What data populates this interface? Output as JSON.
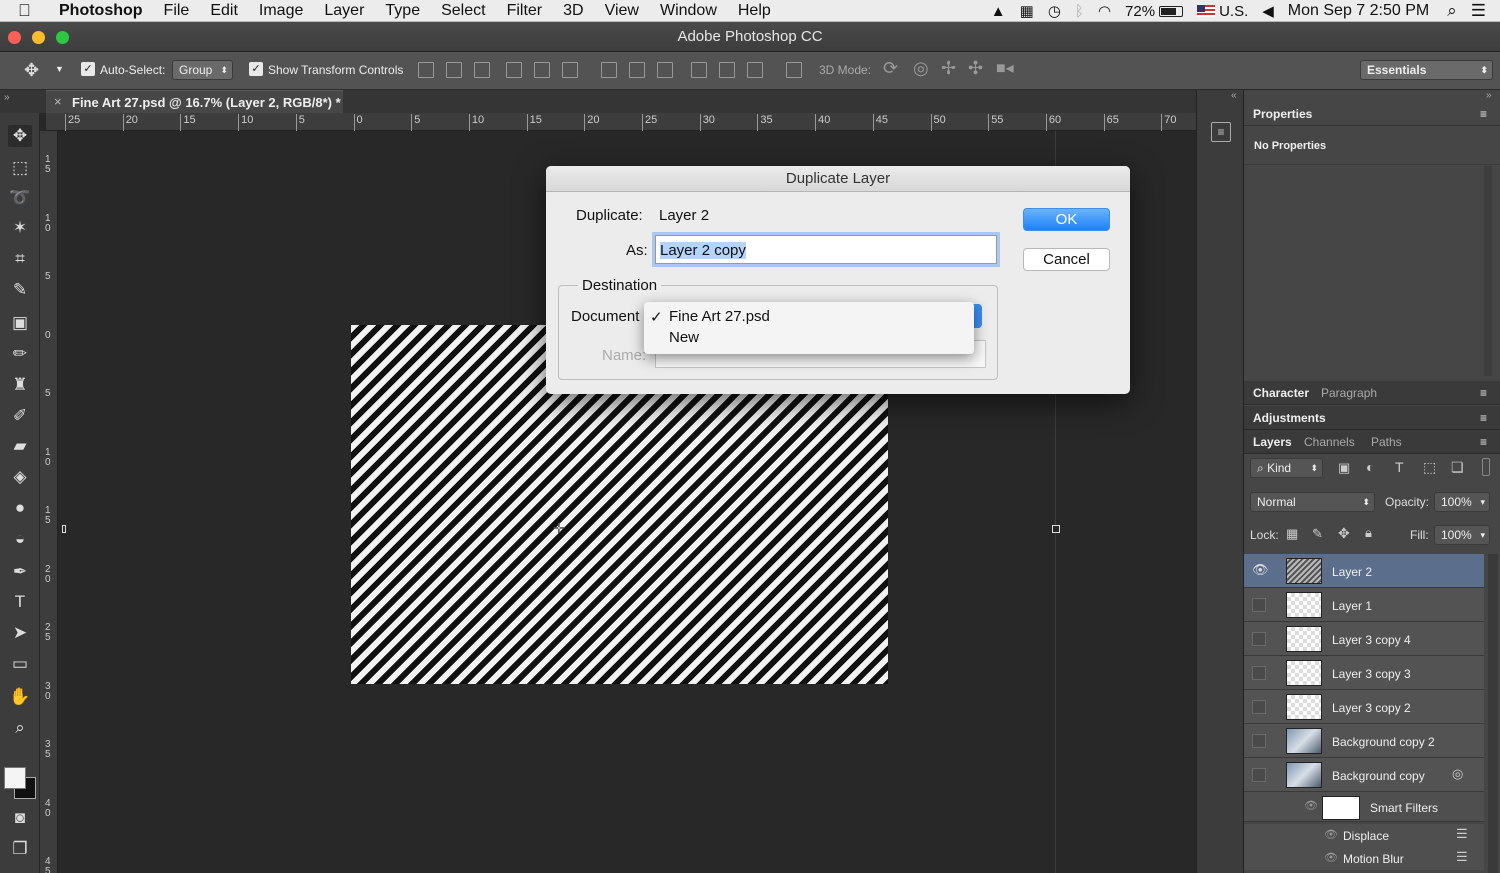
{
  "menubar": {
    "app": "Photoshop",
    "items": [
      "File",
      "Edit",
      "Image",
      "Layer",
      "Type",
      "Select",
      "Filter",
      "3D",
      "View",
      "Window",
      "Help"
    ],
    "battery": "72%",
    "input_source": "U.S.",
    "clock": "Mon Sep 7  2:50 PM"
  },
  "window": {
    "title": "Adobe Photoshop CC"
  },
  "options": {
    "auto_select_label": "Auto-Select:",
    "auto_select_value": "Group",
    "show_transform_label": "Show Transform Controls",
    "mode_3d_label": "3D Mode:",
    "workspace": "Essentials"
  },
  "document_tab": {
    "label": "Fine Art 27.psd @ 16.7% (Layer 2, RGB/8*) *"
  },
  "ruler": {
    "h_ticks": [
      "25",
      "20",
      "15",
      "10",
      "5",
      "0",
      "5",
      "10",
      "15",
      "20",
      "25",
      "30",
      "35",
      "40",
      "45",
      "50",
      "55",
      "60",
      "65",
      "70"
    ],
    "v_ticks": [
      "15",
      "10",
      "5",
      "0",
      "5",
      "10",
      "15",
      "20",
      "25",
      "30",
      "35",
      "40",
      "45"
    ]
  },
  "dialog": {
    "title": "Duplicate Layer",
    "duplicate_label": "Duplicate:",
    "duplicate_value": "Layer 2",
    "as_label": "As:",
    "as_value": "Layer 2 copy",
    "destination_label": "Destination",
    "document_label": "Document",
    "name_label": "Name:",
    "ok": "OK",
    "cancel": "Cancel",
    "menu_options": [
      {
        "label": "Fine Art 27.psd",
        "check": "✓"
      },
      {
        "label": "New",
        "check": ""
      }
    ]
  },
  "panels": {
    "properties_tab": "Properties",
    "properties_empty": "No Properties",
    "character_tab": "Character",
    "paragraph_tab": "Paragraph",
    "adjustments_tab": "Adjustments",
    "layers_tab": "Layers",
    "channels_tab": "Channels",
    "paths_tab": "Paths",
    "kind_filter": "Kind",
    "blend_mode": "Normal",
    "opacity_label": "Opacity:",
    "opacity_value": "100%",
    "lock_label": "Lock:",
    "fill_label": "Fill:",
    "fill_value": "100%"
  },
  "layers": [
    {
      "name": "Layer 2",
      "visible": true
    },
    {
      "name": "Layer 1"
    },
    {
      "name": "Layer 3 copy 4"
    },
    {
      "name": "Layer 3 copy 3"
    },
    {
      "name": "Layer 3 copy 2"
    },
    {
      "name": "Background copy 2"
    },
    {
      "name": "Background copy"
    }
  ],
  "smart_filters": {
    "label": "Smart Filters",
    "items": [
      "Displace",
      "Motion Blur"
    ]
  }
}
